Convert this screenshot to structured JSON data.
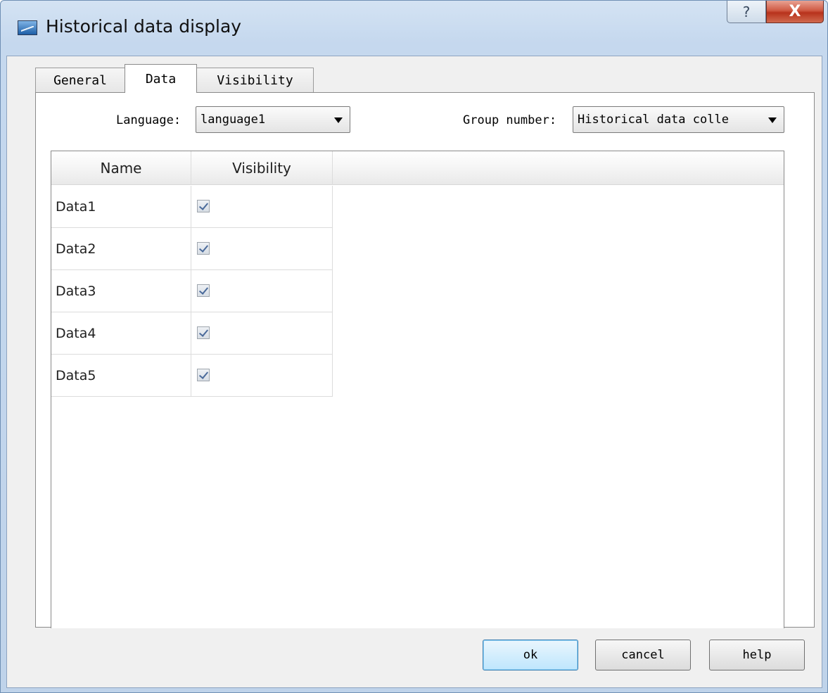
{
  "window": {
    "title": "Historical data display",
    "help_glyph": "?",
    "close_glyph": "X"
  },
  "tabs": [
    {
      "label": "General",
      "active": false
    },
    {
      "label": "Data",
      "active": true
    },
    {
      "label": "Visibility",
      "active": false
    }
  ],
  "language": {
    "label": "Language:",
    "value": "language1"
  },
  "group_number": {
    "label": "Group number:",
    "value": "Historical data colle"
  },
  "table": {
    "columns": [
      "Name",
      "Visibility"
    ],
    "rows": [
      {
        "name": "Data1",
        "visible": true
      },
      {
        "name": "Data2",
        "visible": true
      },
      {
        "name": "Data3",
        "visible": true
      },
      {
        "name": "Data4",
        "visible": true
      },
      {
        "name": "Data5",
        "visible": true
      }
    ]
  },
  "buttons": {
    "ok": "ok",
    "cancel": "cancel",
    "help": "help"
  },
  "colors": {
    "title_bar": "#c5d8ee",
    "close_button": "#c7452e",
    "default_button": "#bee6fd"
  }
}
